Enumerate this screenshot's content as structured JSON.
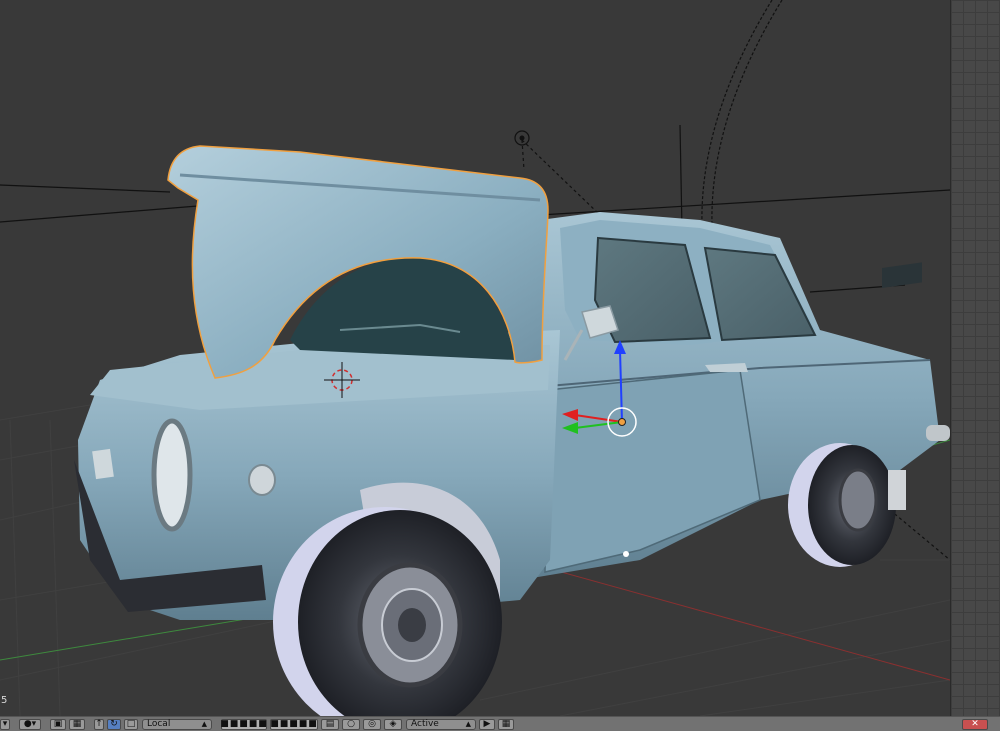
{
  "app": "Blender 3D Viewport",
  "viewport": {
    "frame_label": "5",
    "selected_object": "hood / bonnet"
  },
  "header": {
    "pivot_label": "Local",
    "active_label": "Active",
    "icons": [
      "object-mode-icon",
      "viewport-shade-icon",
      "pivot-icon",
      "manipulator-icon",
      "translate-icon",
      "rotate-icon",
      "scale-icon",
      "layers-icon",
      "lock-icon",
      "snap-icon",
      "proportional-icon",
      "render-icon",
      "camera-icon"
    ]
  },
  "colors": {
    "viewport_bg": "#393939",
    "car_body": "#8fb2c4",
    "selection_outline": "#f0a040",
    "axis_x": "#e02020",
    "axis_y": "#20c020",
    "axis_z": "#2040ff"
  }
}
